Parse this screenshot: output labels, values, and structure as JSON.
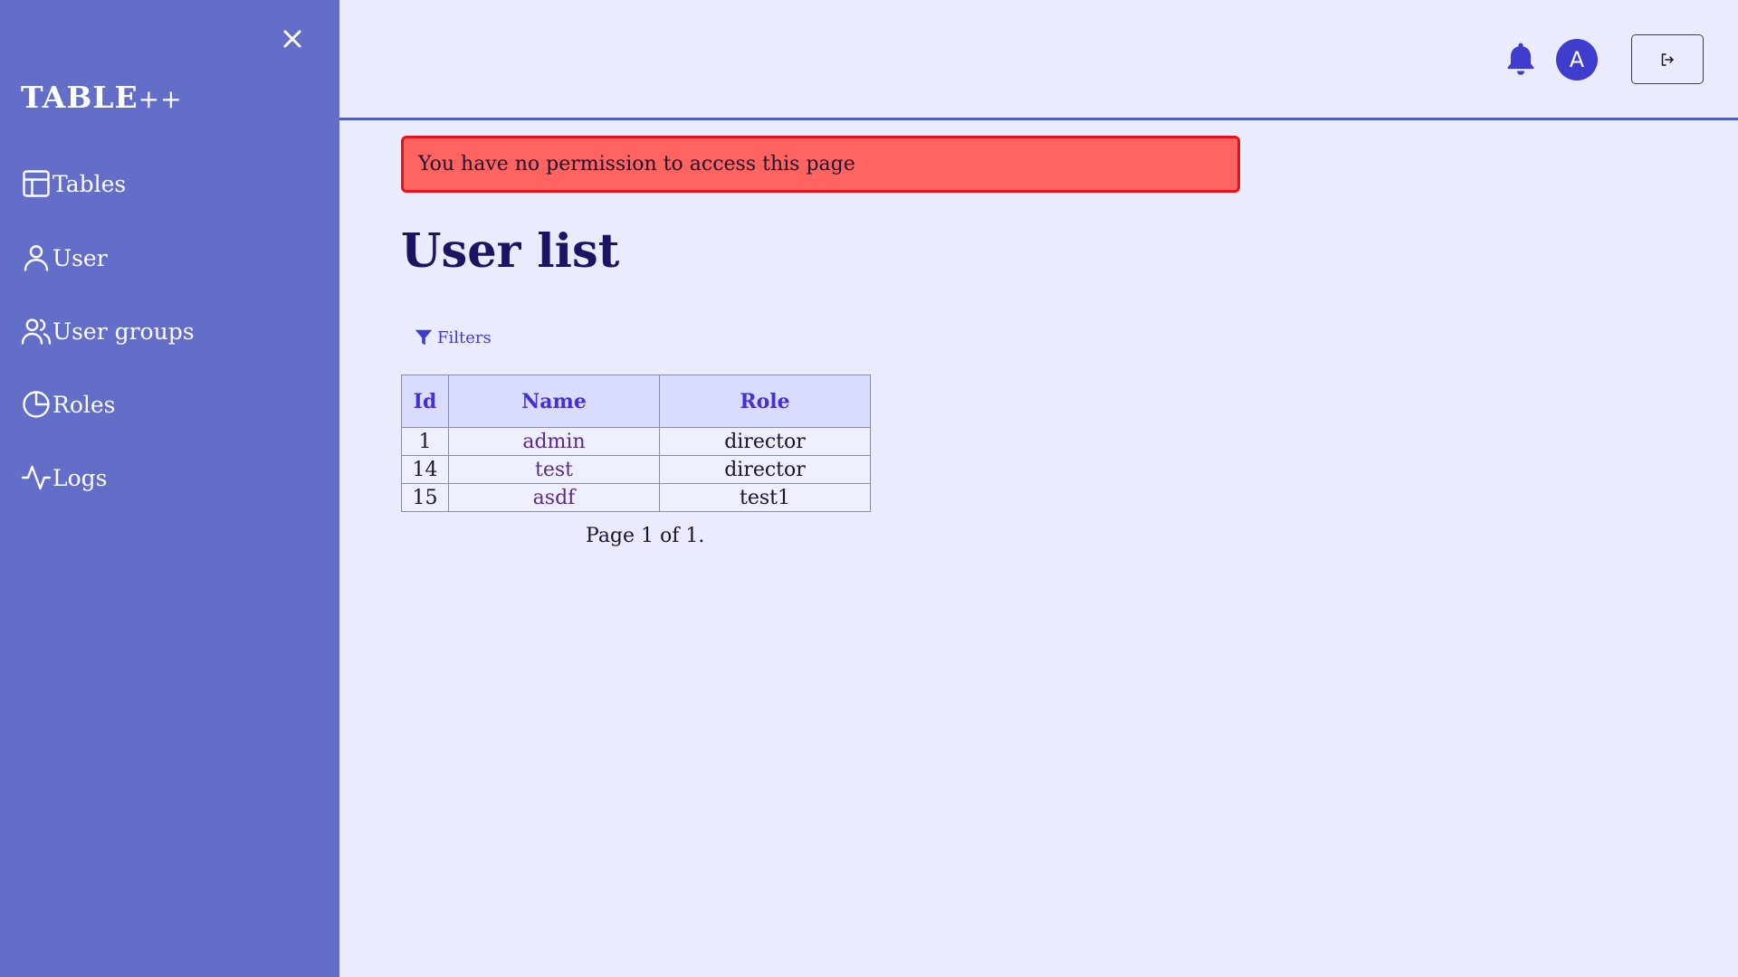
{
  "sidebar": {
    "brand_main": "TABLE",
    "brand_suffix": "++",
    "items": [
      {
        "label": "Tables",
        "icon": "table-icon"
      },
      {
        "label": "User",
        "icon": "user-icon"
      },
      {
        "label": "User groups",
        "icon": "users-icon"
      },
      {
        "label": "Roles",
        "icon": "pie-chart-icon"
      },
      {
        "label": "Logs",
        "icon": "activity-icon"
      }
    ]
  },
  "header": {
    "avatar_initial": "A",
    "icons": [
      "bell-icon",
      "logout-icon",
      "close-icon"
    ]
  },
  "alert": {
    "message": "You have no permission to access this page",
    "color": "#ff6461"
  },
  "main": {
    "title": "User list",
    "filters_label": "Filters",
    "table": {
      "columns": [
        "Id",
        "Name",
        "Role"
      ],
      "rows": [
        [
          "1",
          "admin",
          "director"
        ],
        [
          "14",
          "test",
          "director"
        ],
        [
          "15",
          "asdf",
          "test1"
        ]
      ]
    },
    "pagination": "Page 1 of 1."
  },
  "colors": {
    "sidebar": "#636ec8",
    "background": "#eaecfe",
    "accent": "#3f3dce",
    "title": "#1c1463"
  }
}
